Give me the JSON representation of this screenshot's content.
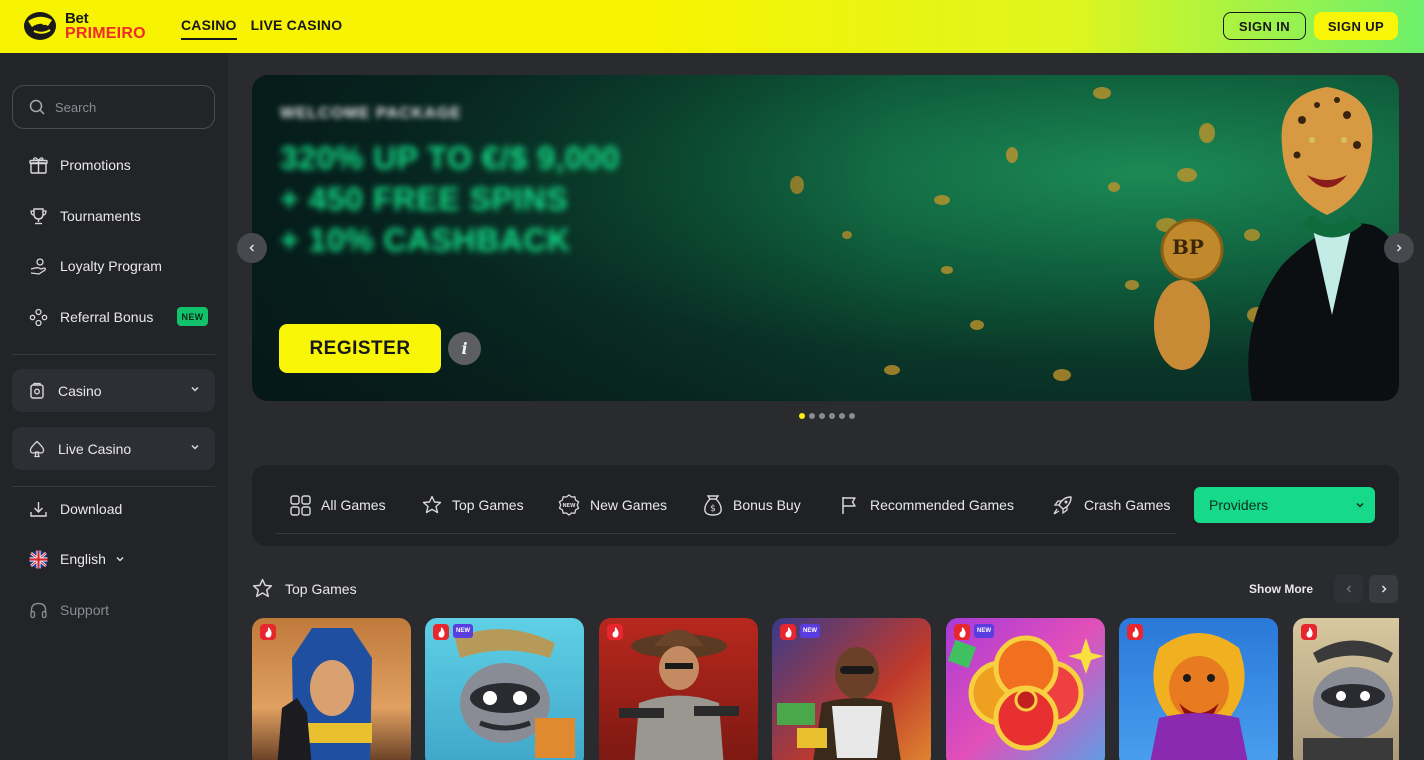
{
  "brand": {
    "line1": "Bet",
    "line2": "PRIMEIRO"
  },
  "header": {
    "nav": [
      "CASINO",
      "LIVE CASINO"
    ],
    "active_nav": "CASINO",
    "sign_in": "SIGN IN",
    "sign_up": "SIGN UP"
  },
  "sidebar": {
    "search_placeholder": "Search",
    "items": [
      {
        "label": "Promotions",
        "icon": "gift-icon"
      },
      {
        "label": "Tournaments",
        "icon": "trophy-icon"
      },
      {
        "label": "Loyalty Program",
        "icon": "loyalty-icon"
      },
      {
        "label": "Referral Bonus",
        "icon": "referral-icon",
        "badge": "NEW"
      }
    ],
    "groups": [
      {
        "label": "Casino",
        "icon": "casino-icon"
      },
      {
        "label": "Live Casino",
        "icon": "spade-icon"
      }
    ],
    "bottom": [
      {
        "label": "Download",
        "icon": "download-icon"
      },
      {
        "label": "English",
        "icon": "uk-flag-icon"
      },
      {
        "label": "Support",
        "icon": "headset-icon"
      }
    ]
  },
  "banner": {
    "subtitle": "WELCOME PACKAGE",
    "lines": [
      "320% UP TO €/$ 9,000",
      "+ 450 FREE SPINS",
      "+ 10% CASHBACK"
    ],
    "register": "REGISTER",
    "info": "i",
    "coin_text": "BP",
    "slides": 6,
    "active_slide": 1
  },
  "categories": {
    "items": [
      {
        "label": "All Games",
        "icon": "grid-icon"
      },
      {
        "label": "Top Games",
        "icon": "star-icon"
      },
      {
        "label": "New Games",
        "icon": "new-badge-icon"
      },
      {
        "label": "Bonus Buy",
        "icon": "money-bag-icon"
      },
      {
        "label": "Recommended Games",
        "icon": "flag-icon"
      },
      {
        "label": "Crash Games",
        "icon": "rocket-icon"
      }
    ],
    "providers": "Providers"
  },
  "top_games": {
    "title": "Top Games",
    "show_more": "Show More",
    "new_label": "NEW",
    "tiles": [
      {
        "hot": true,
        "new": false
      },
      {
        "hot": true,
        "new": true
      },
      {
        "hot": true,
        "new": false
      },
      {
        "hot": true,
        "new": true
      },
      {
        "hot": true,
        "new": true
      },
      {
        "hot": true,
        "new": false
      },
      {
        "hot": true,
        "new": false
      }
    ]
  },
  "colors": {
    "accent_yellow": "#f8f507",
    "accent_green": "#16d98a",
    "hot_red": "#e8262d",
    "bg": "#2a2b2f"
  }
}
